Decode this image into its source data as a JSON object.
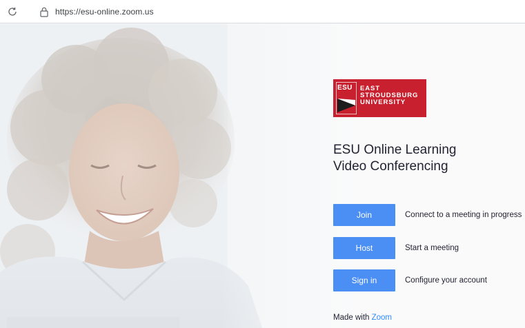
{
  "browser": {
    "url": "https://esu-online.zoom.us"
  },
  "logo": {
    "mark": "ESU",
    "line1": "EAST",
    "line2": "STROUDSBURG",
    "line3": "UNIVERSITY",
    "color": "#c8202f"
  },
  "title": {
    "line1": "ESU Online Learning",
    "line2": "Video Conferencing"
  },
  "actions": [
    {
      "label": "Join",
      "description": "Connect to a meeting in progress"
    },
    {
      "label": "Host",
      "description": "Start a meeting"
    },
    {
      "label": "Sign in",
      "description": "Configure your account"
    }
  ],
  "footer": {
    "prefix": "Made with",
    "link": "Zoom"
  },
  "colors": {
    "button": "#4b8ff5",
    "link": "#2d8cff"
  },
  "icons": {
    "reload": "reload-icon",
    "lock": "lock-icon"
  }
}
